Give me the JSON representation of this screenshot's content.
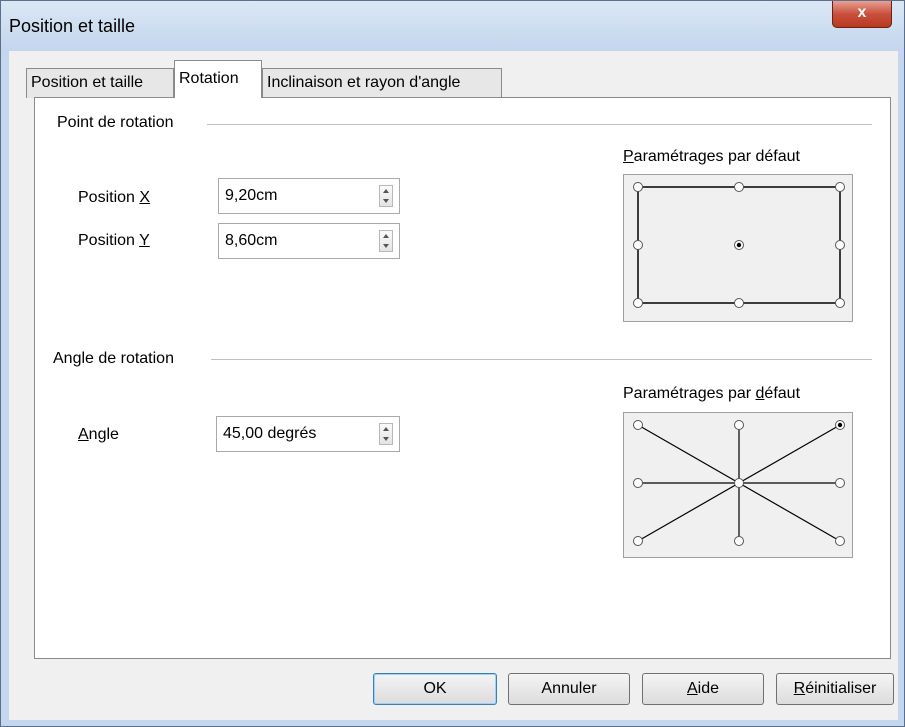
{
  "window": {
    "title": "Position et taille",
    "close_label": "x"
  },
  "tabs": [
    {
      "label": "Position et taille"
    },
    {
      "label": "Rotation"
    },
    {
      "label": "Inclinaison et rayon d'angle"
    }
  ],
  "pivot": {
    "section_title": "Point de rotation",
    "pos_x_label_pre": "Position ",
    "pos_x_label_key": "X",
    "pos_x_value": "9,20cm",
    "pos_y_label_pre": "Position ",
    "pos_y_label_key": "Y",
    "pos_y_value": "8,60cm",
    "defaults_key": "P",
    "defaults_rest": "aramétrages par défaut",
    "selected_point": "center"
  },
  "angle": {
    "section_title": "Angle de rotation",
    "angle_label_key": "A",
    "angle_label_rest": "ngle",
    "angle_value": "45,00 degrés",
    "defaults_pre": "Paramétrages par ",
    "defaults_key": "d",
    "defaults_rest": "éfaut",
    "selected_point": "top-right"
  },
  "buttons": {
    "ok": "OK",
    "cancel": "Annuler",
    "help_key": "A",
    "help_rest": "ide",
    "reset_key": "R",
    "reset_rest": "éinitialiser"
  }
}
